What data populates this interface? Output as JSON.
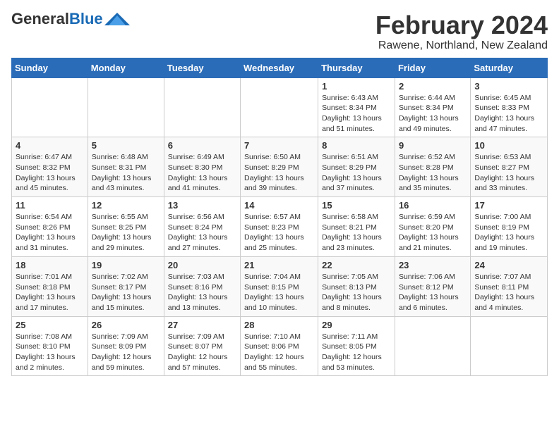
{
  "logo": {
    "general": "General",
    "blue": "Blue"
  },
  "title": "February 2024",
  "location": "Rawene, Northland, New Zealand",
  "days_of_week": [
    "Sunday",
    "Monday",
    "Tuesday",
    "Wednesday",
    "Thursday",
    "Friday",
    "Saturday"
  ],
  "weeks": [
    [
      {
        "day": "",
        "info": ""
      },
      {
        "day": "",
        "info": ""
      },
      {
        "day": "",
        "info": ""
      },
      {
        "day": "",
        "info": ""
      },
      {
        "day": "1",
        "info": "Sunrise: 6:43 AM\nSunset: 8:34 PM\nDaylight: 13 hours and 51 minutes."
      },
      {
        "day": "2",
        "info": "Sunrise: 6:44 AM\nSunset: 8:34 PM\nDaylight: 13 hours and 49 minutes."
      },
      {
        "day": "3",
        "info": "Sunrise: 6:45 AM\nSunset: 8:33 PM\nDaylight: 13 hours and 47 minutes."
      }
    ],
    [
      {
        "day": "4",
        "info": "Sunrise: 6:47 AM\nSunset: 8:32 PM\nDaylight: 13 hours and 45 minutes."
      },
      {
        "day": "5",
        "info": "Sunrise: 6:48 AM\nSunset: 8:31 PM\nDaylight: 13 hours and 43 minutes."
      },
      {
        "day": "6",
        "info": "Sunrise: 6:49 AM\nSunset: 8:30 PM\nDaylight: 13 hours and 41 minutes."
      },
      {
        "day": "7",
        "info": "Sunrise: 6:50 AM\nSunset: 8:29 PM\nDaylight: 13 hours and 39 minutes."
      },
      {
        "day": "8",
        "info": "Sunrise: 6:51 AM\nSunset: 8:29 PM\nDaylight: 13 hours and 37 minutes."
      },
      {
        "day": "9",
        "info": "Sunrise: 6:52 AM\nSunset: 8:28 PM\nDaylight: 13 hours and 35 minutes."
      },
      {
        "day": "10",
        "info": "Sunrise: 6:53 AM\nSunset: 8:27 PM\nDaylight: 13 hours and 33 minutes."
      }
    ],
    [
      {
        "day": "11",
        "info": "Sunrise: 6:54 AM\nSunset: 8:26 PM\nDaylight: 13 hours and 31 minutes."
      },
      {
        "day": "12",
        "info": "Sunrise: 6:55 AM\nSunset: 8:25 PM\nDaylight: 13 hours and 29 minutes."
      },
      {
        "day": "13",
        "info": "Sunrise: 6:56 AM\nSunset: 8:24 PM\nDaylight: 13 hours and 27 minutes."
      },
      {
        "day": "14",
        "info": "Sunrise: 6:57 AM\nSunset: 8:23 PM\nDaylight: 13 hours and 25 minutes."
      },
      {
        "day": "15",
        "info": "Sunrise: 6:58 AM\nSunset: 8:21 PM\nDaylight: 13 hours and 23 minutes."
      },
      {
        "day": "16",
        "info": "Sunrise: 6:59 AM\nSunset: 8:20 PM\nDaylight: 13 hours and 21 minutes."
      },
      {
        "day": "17",
        "info": "Sunrise: 7:00 AM\nSunset: 8:19 PM\nDaylight: 13 hours and 19 minutes."
      }
    ],
    [
      {
        "day": "18",
        "info": "Sunrise: 7:01 AM\nSunset: 8:18 PM\nDaylight: 13 hours and 17 minutes."
      },
      {
        "day": "19",
        "info": "Sunrise: 7:02 AM\nSunset: 8:17 PM\nDaylight: 13 hours and 15 minutes."
      },
      {
        "day": "20",
        "info": "Sunrise: 7:03 AM\nSunset: 8:16 PM\nDaylight: 13 hours and 13 minutes."
      },
      {
        "day": "21",
        "info": "Sunrise: 7:04 AM\nSunset: 8:15 PM\nDaylight: 13 hours and 10 minutes."
      },
      {
        "day": "22",
        "info": "Sunrise: 7:05 AM\nSunset: 8:13 PM\nDaylight: 13 hours and 8 minutes."
      },
      {
        "day": "23",
        "info": "Sunrise: 7:06 AM\nSunset: 8:12 PM\nDaylight: 13 hours and 6 minutes."
      },
      {
        "day": "24",
        "info": "Sunrise: 7:07 AM\nSunset: 8:11 PM\nDaylight: 13 hours and 4 minutes."
      }
    ],
    [
      {
        "day": "25",
        "info": "Sunrise: 7:08 AM\nSunset: 8:10 PM\nDaylight: 13 hours and 2 minutes."
      },
      {
        "day": "26",
        "info": "Sunrise: 7:09 AM\nSunset: 8:09 PM\nDaylight: 12 hours and 59 minutes."
      },
      {
        "day": "27",
        "info": "Sunrise: 7:09 AM\nSunset: 8:07 PM\nDaylight: 12 hours and 57 minutes."
      },
      {
        "day": "28",
        "info": "Sunrise: 7:10 AM\nSunset: 8:06 PM\nDaylight: 12 hours and 55 minutes."
      },
      {
        "day": "29",
        "info": "Sunrise: 7:11 AM\nSunset: 8:05 PM\nDaylight: 12 hours and 53 minutes."
      },
      {
        "day": "",
        "info": ""
      },
      {
        "day": "",
        "info": ""
      }
    ]
  ]
}
